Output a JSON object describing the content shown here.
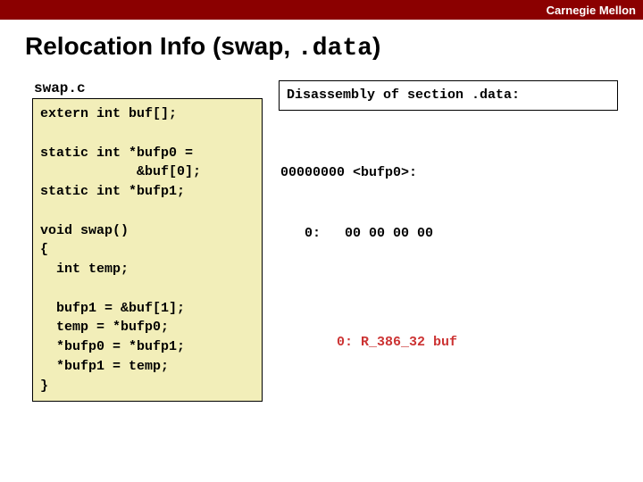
{
  "topbar": {
    "brand": "Carnegie Mellon"
  },
  "title": {
    "prefix": "Relocation Info (swap, ",
    "mono": ".data",
    "suffix": ")"
  },
  "left": {
    "filename": "swap.c",
    "code": "extern int buf[];\n\nstatic int *bufp0 =\n            &buf[0];\nstatic int *bufp1;\n\nvoid swap()\n{\n  int temp;\n\n  bufp1 = &buf[1];\n  temp = *bufp0;\n  *bufp0 = *bufp1;\n  *bufp1 = temp;\n}"
  },
  "right": {
    "disasm_header": "Disassembly of section .data:",
    "block1_line1": "00000000 <bufp0>:",
    "block1_line2": "   0:   00 00 00 00",
    "reloc_line": "       0: R_386_32 buf"
  }
}
